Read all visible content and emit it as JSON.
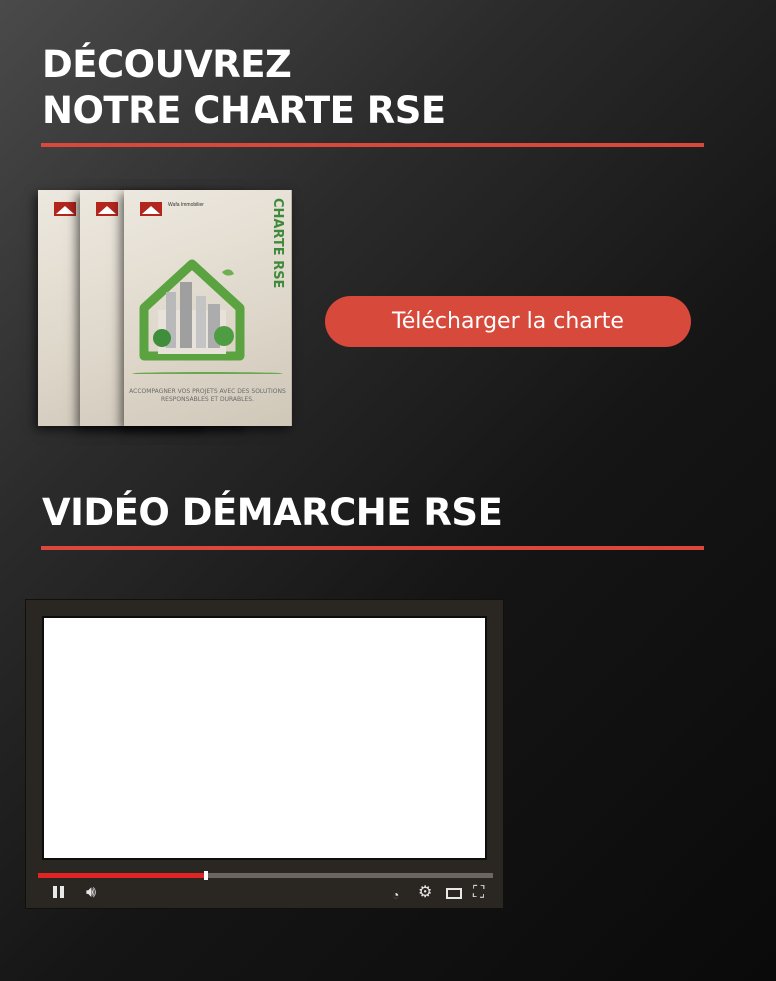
{
  "section_charter": {
    "title_line1": "DÉCOUVREZ",
    "title_line2": "NOTRE CHARTE RSE",
    "download_button": "Télécharger la charte",
    "brochure": {
      "vertical_title": "CHARTE RSE",
      "logo_text": "Wafa Immobilier",
      "tagline": "ACCOMPAGNER VOS PROJETS AVEC DES SOLUTIONS RESPONSABLES ET DURABLES."
    }
  },
  "section_video": {
    "title": "VIDÉO DÉMARCHE RSE",
    "player": {
      "progress_fraction": 0.37,
      "icons": [
        "pause-icon",
        "volume-icon",
        "clock-icon",
        "gear-icon",
        "screen-icon",
        "fullscreen-icon"
      ]
    }
  },
  "colors": {
    "accent": "#d9483b",
    "button": "#d6493b",
    "progress": "#e02424"
  }
}
